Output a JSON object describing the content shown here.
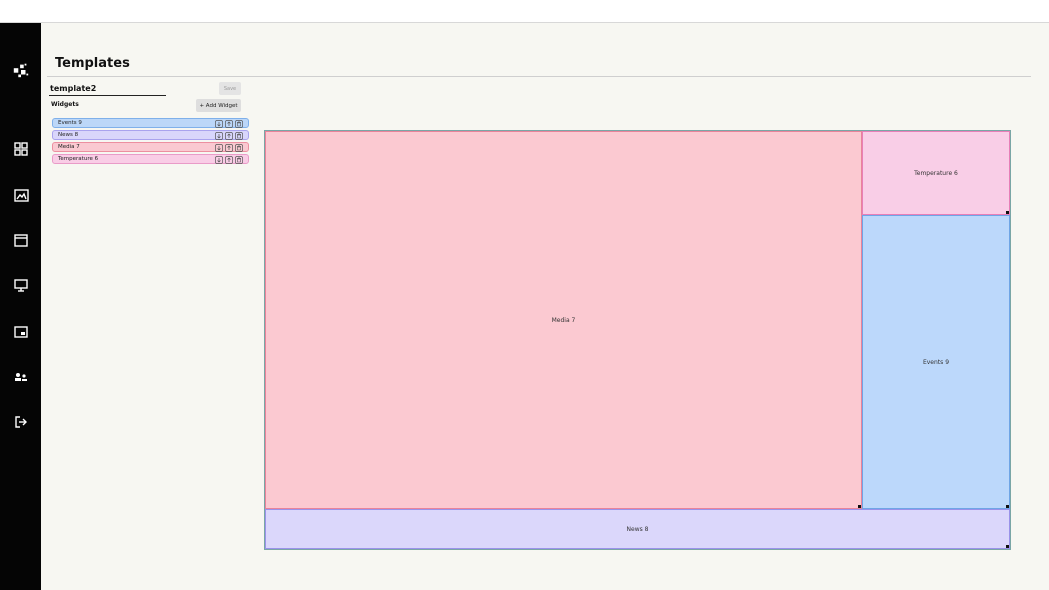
{
  "page": {
    "title": "Templates"
  },
  "template": {
    "name_value": "template2",
    "save_label": "Save"
  },
  "widgets_section": {
    "label": "Widgets",
    "add_label": "+ Add Widget",
    "items": [
      {
        "label": "Events 9",
        "color": "#bcd7f8",
        "border": "#7fb0ea"
      },
      {
        "label": "News 8",
        "color": "#d9d6fb",
        "border": "#a9a3ee"
      },
      {
        "label": "Media 7",
        "color": "#fac9d1",
        "border": "#ec8fa0"
      },
      {
        "label": "Temperature 6",
        "color": "#f9cde6",
        "border": "#e99bc8"
      }
    ]
  },
  "layout": {
    "regions": [
      {
        "label": "Media 7",
        "color": "#fbc9d1",
        "border": "#e9839a"
      },
      {
        "label": "Temperature 6",
        "color": "#f9cee7",
        "border": "#e87fb8"
      },
      {
        "label": "Events 9",
        "color": "#bcd8fb",
        "border": "#6fa5e6"
      },
      {
        "label": "News 8",
        "color": "#dbd7fb",
        "border": "#9a92ea"
      }
    ]
  },
  "sidebar": {
    "icons": [
      "logo-icon",
      "dashboard-icon",
      "images-icon",
      "calendar-icon",
      "display-icon",
      "widget-icon",
      "users-icon",
      "logout-icon"
    ]
  }
}
